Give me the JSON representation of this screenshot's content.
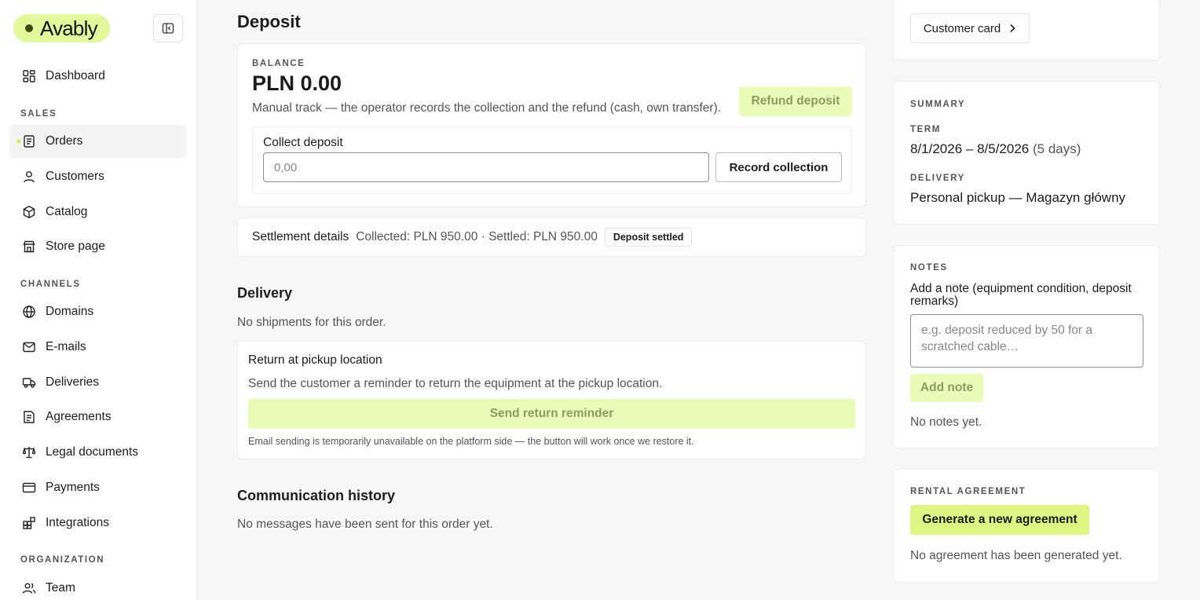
{
  "brand": {
    "name": "Avably"
  },
  "sidebar": {
    "sections": {
      "sales": "SALES",
      "channels": "CHANNELS",
      "organization": "ORGANIZATION"
    },
    "items": [
      {
        "label": "Dashboard",
        "icon": "dashboard-icon"
      },
      {
        "label": "Orders",
        "icon": "orders-icon",
        "active": true
      },
      {
        "label": "Customers",
        "icon": "user-icon"
      },
      {
        "label": "Catalog",
        "icon": "box-icon"
      },
      {
        "label": "Store page",
        "icon": "store-icon"
      },
      {
        "label": "Domains",
        "icon": "globe-icon"
      },
      {
        "label": "E-mails",
        "icon": "mail-icon"
      },
      {
        "label": "Deliveries",
        "icon": "truck-icon"
      },
      {
        "label": "Agreements",
        "icon": "agreement-icon"
      },
      {
        "label": "Legal documents",
        "icon": "scale-icon"
      },
      {
        "label": "Payments",
        "icon": "card-icon"
      },
      {
        "label": "Integrations",
        "icon": "integrations-icon"
      },
      {
        "label": "Team",
        "icon": "team-icon"
      }
    ]
  },
  "deposit": {
    "title": "Deposit",
    "balance_label": "BALANCE",
    "balance_value": "PLN 0.00",
    "description": "Manual track — the operator records the collection and the refund (cash, own transfer).",
    "refund_button": "Refund deposit",
    "collect_label": "Collect deposit",
    "collect_placeholder": "0,00",
    "record_button": "Record collection",
    "settlement_title": "Settlement details",
    "settlement_info": "Collected: PLN 950.00 · Settled: PLN 950.00",
    "settlement_badge": "Deposit settled"
  },
  "delivery": {
    "title": "Delivery",
    "empty": "No shipments for this order.",
    "return_title": "Return at pickup location",
    "return_text": "Send the customer a reminder to return the equipment at the pickup location.",
    "reminder_button": "Send return reminder",
    "notice": "Email sending is temporarily unavailable on the platform side — the button will work once we restore it."
  },
  "communication": {
    "title": "Communication history",
    "empty": "No messages have been sent for this order yet."
  },
  "right": {
    "customer_card_button": "Customer card",
    "summary": {
      "label": "SUMMARY",
      "term_label": "TERM",
      "term_value": "8/1/2026 – 8/5/2026",
      "term_days": "(5 days)",
      "delivery_label": "DELIVERY",
      "delivery_value": "Personal pickup — Magazyn główny"
    },
    "notes": {
      "label": "NOTES",
      "field_label": "Add a note (equipment condition, deposit remarks)",
      "placeholder": "e.g. deposit reduced by 50 for a scratched cable…",
      "add_button": "Add note",
      "empty": "No notes yet."
    },
    "agreement": {
      "label": "RENTAL AGREEMENT",
      "generate_button": "Generate a new agreement",
      "empty": "No agreement has been generated yet."
    }
  },
  "colors": {
    "accent": "#dcf681",
    "accent_disabled": "#ecfbb8",
    "logo_bg": "#e2f89b"
  }
}
